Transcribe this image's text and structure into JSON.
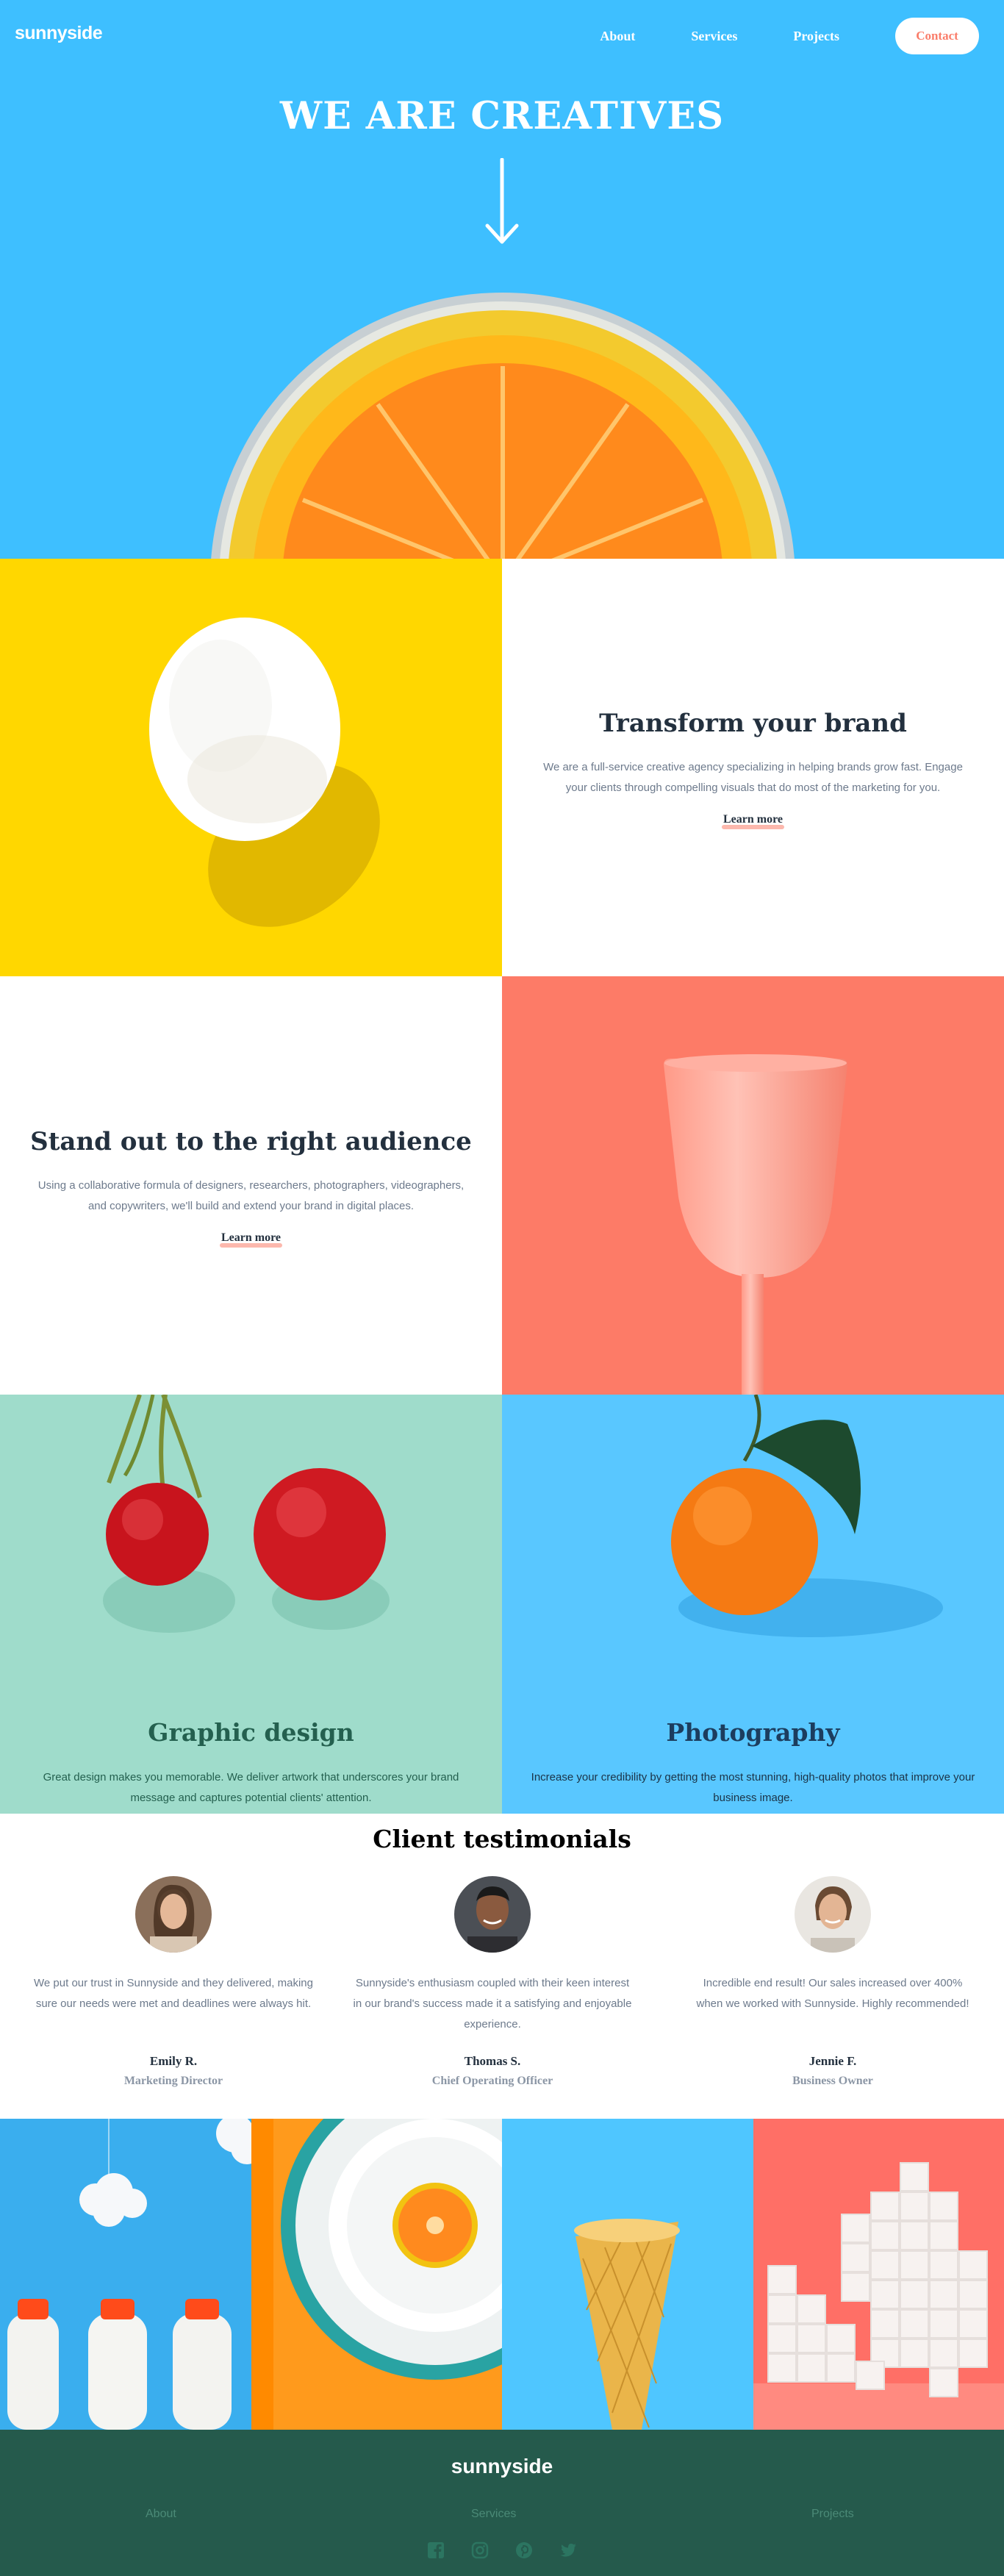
{
  "header": {
    "logo": "sunnyside",
    "nav": [
      "About",
      "Services",
      "Projects"
    ],
    "cta": "Contact"
  },
  "hero": {
    "title": "WE ARE CREATIVES"
  },
  "features": [
    {
      "title": "Transform your brand",
      "body": "We are a full-service creative agency specializing in helping brands grow fast. Engage your clients through compelling visuals that do most of the marketing for you.",
      "link": "Learn more"
    },
    {
      "title": "Stand out to the right audience",
      "body": "Using a collaborative formula of designers, researchers, photographers, videographers, and copywriters, we'll build and extend your brand in digital places.",
      "link": "Learn more"
    }
  ],
  "services": [
    {
      "title": "Graphic design",
      "body": "Great design makes you memorable. We deliver artwork that underscores your brand message and captures potential clients' attention."
    },
    {
      "title": "Photography",
      "body": "Increase your credibility by getting the most stunning, high-quality photos that improve your business image."
    }
  ],
  "testimonials": {
    "title": "Client testimonials",
    "items": [
      {
        "text": "We put our trust in Sunnyside and they delivered, making sure our needs were met and deadlines were always hit.",
        "name": "Emily R.",
        "role": "Marketing Director"
      },
      {
        "text": "Sunnyside's enthusiasm coupled with their keen interest in our brand's success made it a satisfying and enjoyable experience.",
        "name": "Thomas S.",
        "role": "Chief Operating Officer"
      },
      {
        "text": "Incredible end result! Our sales increased over 400% when we worked with Sunnyside. Highly recommended!",
        "name": "Jennie F.",
        "role": "Business Owner"
      }
    ]
  },
  "footer": {
    "logo": "sunnyside",
    "links": [
      "About",
      "Services",
      "Projects"
    ],
    "socials": [
      "facebook-icon",
      "instagram-icon",
      "pinterest-icon",
      "twitter-icon"
    ]
  },
  "colors": {
    "hero_blue": "#3ebfff",
    "egg_yellow": "#ffd700",
    "cup_red": "#fd7b67",
    "mint": "#9fdccb",
    "footer_green": "#255a4c",
    "graphic_text": "#24604f",
    "photo_text": "#1c3d5e"
  }
}
